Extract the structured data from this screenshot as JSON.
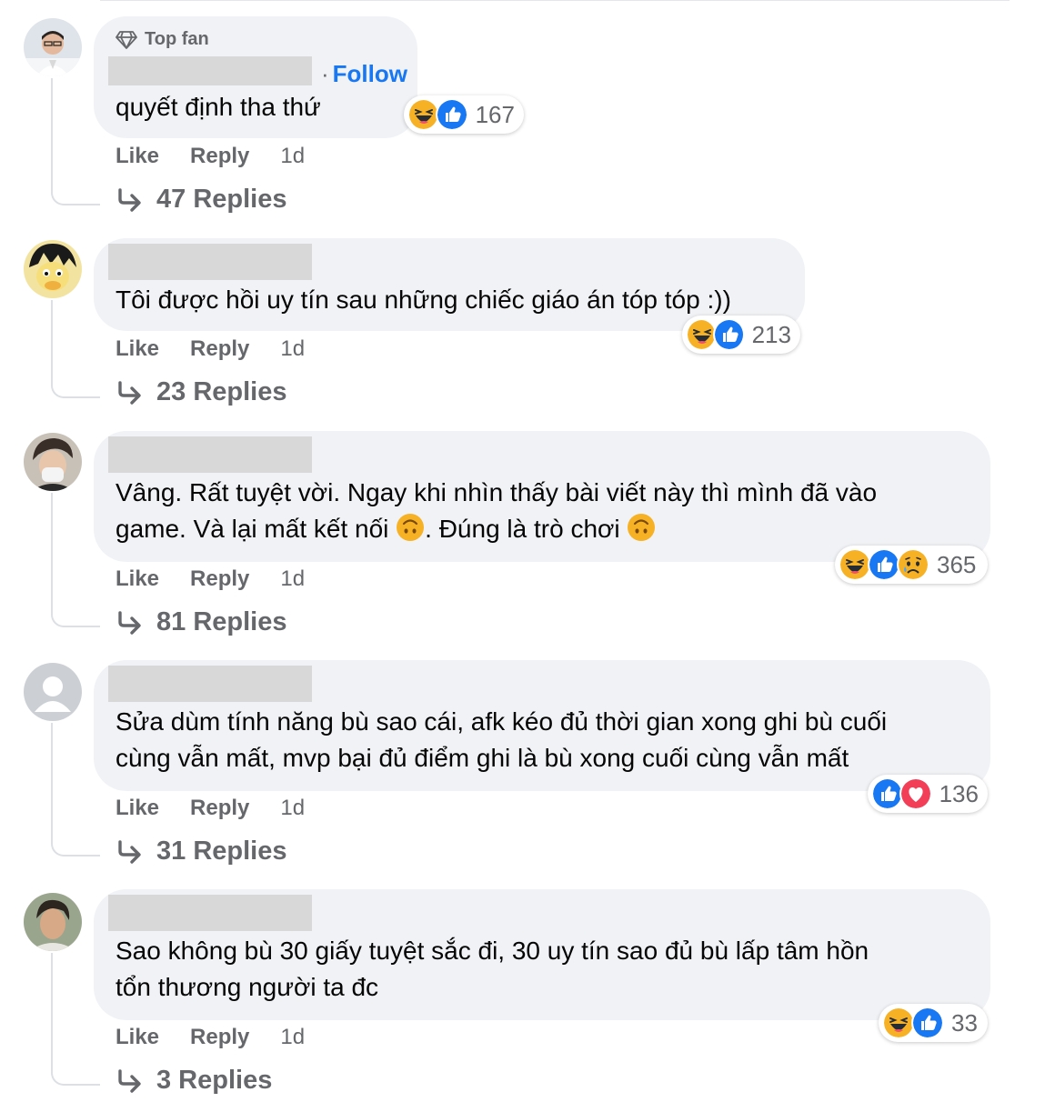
{
  "comments": [
    {
      "badge": "Top fan",
      "follow": "Follow",
      "text_lines": [
        "quyết định tha thứ"
      ],
      "reaction_count": "167",
      "reactions": [
        "haha-icon",
        "like-icon"
      ],
      "actions": {
        "like": "Like",
        "reply": "Reply",
        "time": "1d"
      },
      "replies": "47 Replies"
    },
    {
      "text_lines": [
        "Tôi được hồi uy tín sau những chiếc giáo án tóp tóp :))"
      ],
      "reaction_count": "213",
      "reactions": [
        "haha-icon",
        "like-icon"
      ],
      "actions": {
        "like": "Like",
        "reply": "Reply",
        "time": "1d"
      },
      "replies": "23 Replies"
    },
    {
      "text_parts": {
        "line1": "Vâng. Rất tuyệt vời. Ngay khi nhìn thấy bài viết này thì mình đã vào",
        "line2a": "game. Và lại mất kết nối ",
        "line2b": ". Đúng là trò chơi "
      },
      "reaction_count": "365",
      "reactions": [
        "haha-icon",
        "like-icon",
        "sad-icon"
      ],
      "actions": {
        "like": "Like",
        "reply": "Reply",
        "time": "1d"
      },
      "replies": "81 Replies"
    },
    {
      "text_lines": [
        "Sửa dùm tính năng bù sao cái, afk kéo đủ thời gian xong ghi bù cuối",
        "cùng vẫn mất, mvp bại đủ điểm ghi là bù xong cuối cùng vẫn mất"
      ],
      "reaction_count": "136",
      "reactions": [
        "like-icon",
        "love-icon"
      ],
      "actions": {
        "like": "Like",
        "reply": "Reply",
        "time": "1d"
      },
      "replies": "31 Replies"
    },
    {
      "text_lines": [
        "Sao không bù 30 giấy tuyệt sắc đi, 30 uy tín sao đủ bù lấp tâm hồn",
        "tổn thương người ta đc"
      ],
      "reaction_count": "33",
      "reactions": [
        "haha-icon",
        "like-icon"
      ],
      "actions": {
        "like": "Like",
        "reply": "Reply",
        "time": "1d"
      },
      "replies": "3 Replies"
    }
  ],
  "colors": {
    "bubble": "#f0f2f5",
    "link": "#1877f2",
    "muted": "#65676b",
    "like": "#1877f2",
    "love": "#f33e58",
    "haha": "#f7b125"
  }
}
